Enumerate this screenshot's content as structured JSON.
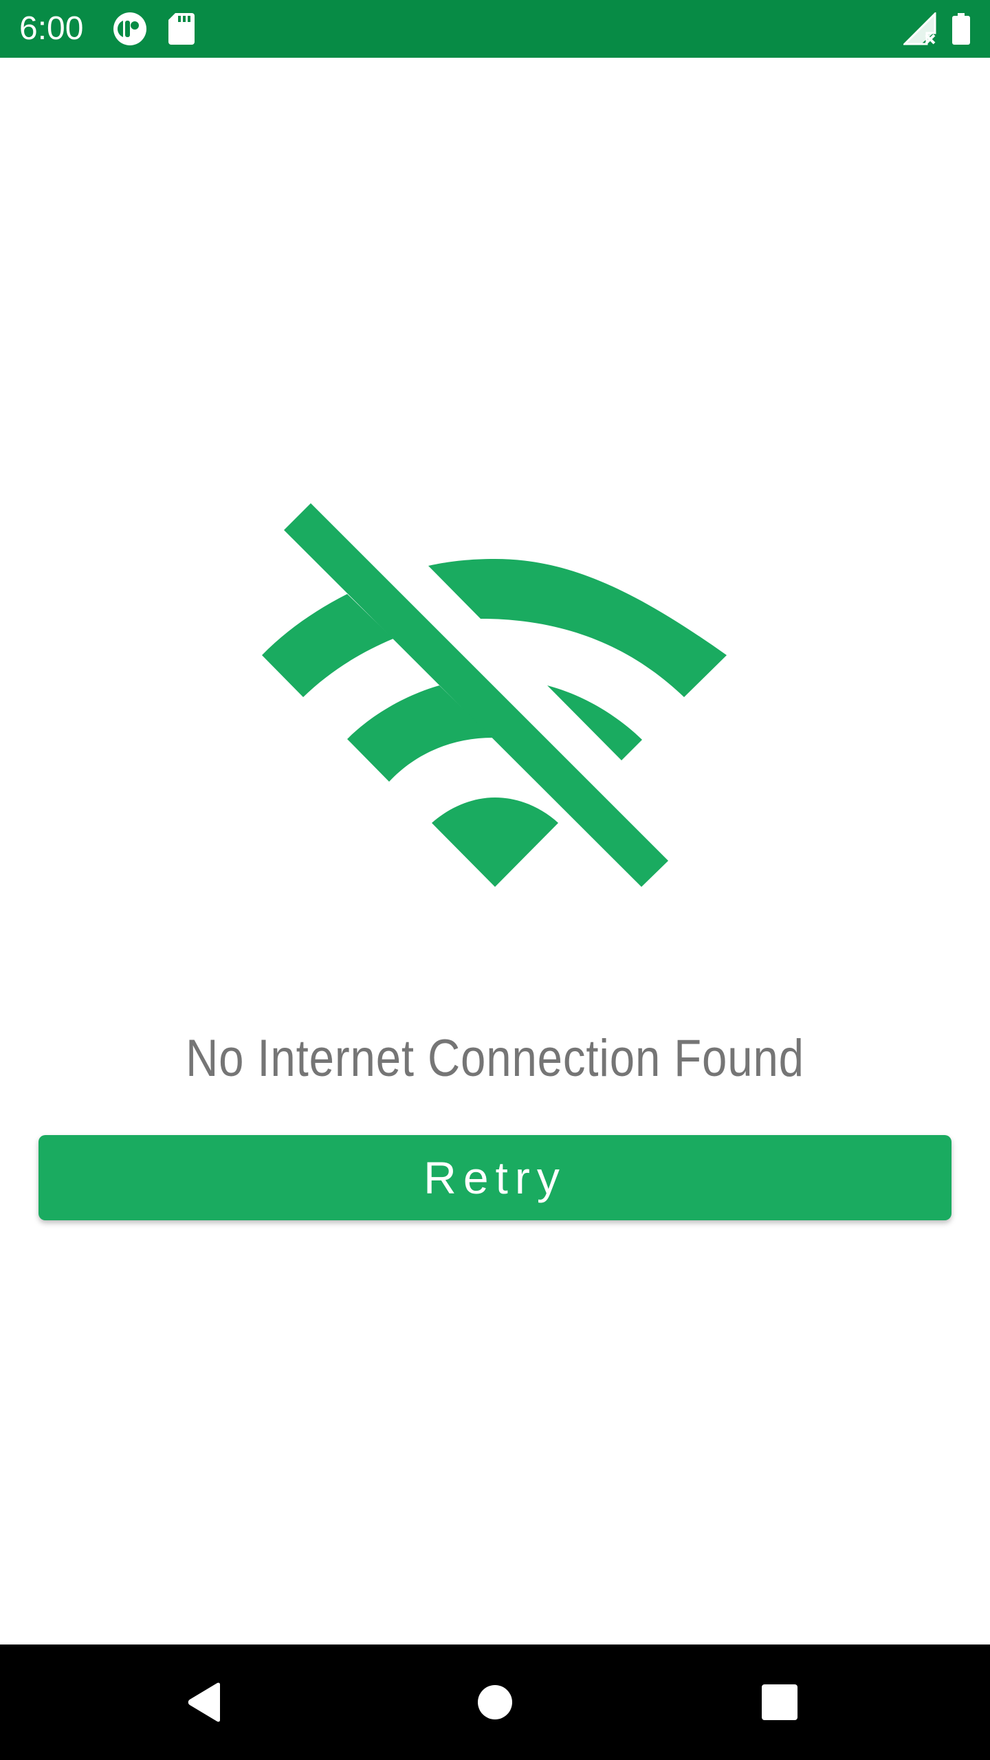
{
  "status_bar": {
    "time": "6:00",
    "background_color": "#078b45",
    "left_icons": [
      "app-notification-icon",
      "sd-card-icon"
    ],
    "right_icons": [
      "signal-no-service-icon",
      "battery-icon"
    ]
  },
  "main": {
    "illustration_icon": "wifi-off-icon",
    "accent_color": "#1aab60",
    "message": "No Internet Connection Found",
    "message_color": "#757575",
    "retry_label": "Retry"
  },
  "nav_bar": {
    "buttons": [
      "back-icon",
      "home-icon",
      "recents-icon"
    ]
  }
}
